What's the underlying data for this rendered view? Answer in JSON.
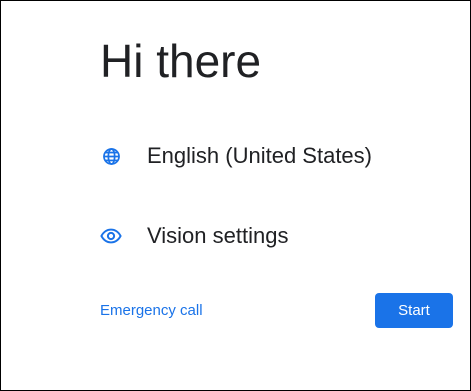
{
  "screen": {
    "title": "Hi there"
  },
  "language_row": {
    "icon": "globe-icon",
    "label": "English (United States)"
  },
  "vision_row": {
    "icon": "eye-icon",
    "label": "Vision settings"
  },
  "footer": {
    "emergency_label": "Emergency call",
    "start_label": "Start"
  },
  "colors": {
    "accent": "#1a73e8",
    "text": "#202124",
    "background": "#ffffff"
  }
}
